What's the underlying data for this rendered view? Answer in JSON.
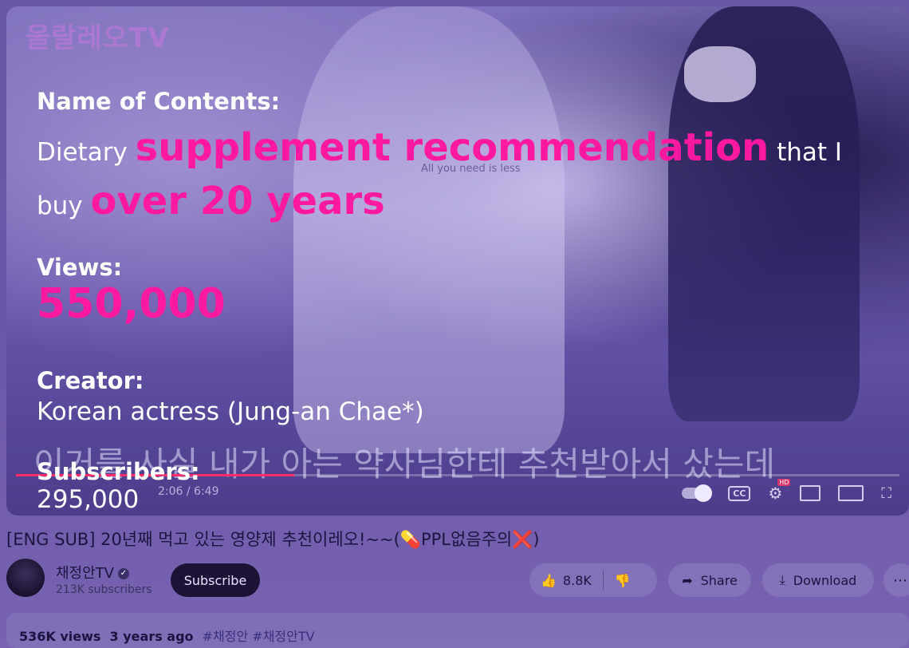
{
  "player": {
    "watermark": "울랄레오TV",
    "shirt_text": "All you need is less",
    "korean_subtitle": "이거를 사실 내가 아는 약사님한테 추천받아서 샀는데",
    "time": "2:06 / 6:49",
    "progress_fraction": 0.315,
    "progress_color": "#ff2a6a",
    "cc_label": "CC",
    "hd_badge": "HD"
  },
  "overlay": {
    "contents_label": "Name of Contents:",
    "contents_pre": "Dietary ",
    "contents_highlight1": "supplement recommendation",
    "contents_mid": " that I buy ",
    "contents_highlight2": "over 20 years",
    "views_label": "Views:",
    "views_value": "550,000",
    "creator_label": "Creator:",
    "creator_value": "Korean actress (Jung-an Chae*)",
    "subscribers_label": "Subscribers:",
    "subscribers_value": "295,000",
    "highlight_color": "#ff18a0"
  },
  "video": {
    "title": "[ENG SUB] 20년째 먹고 있는 영양제 추천이레오!~~(💊PPL없음주의❌)",
    "channel_name": "채정안TV",
    "subscribers": "213K subscribers",
    "subscribe_label": "Subscribe",
    "likes": "8.8K",
    "share_label": "Share",
    "download_label": "Download",
    "more_label": "⋯",
    "views": "536K views",
    "age": "3 years ago",
    "tags": "#채정안 #채정안TV"
  }
}
